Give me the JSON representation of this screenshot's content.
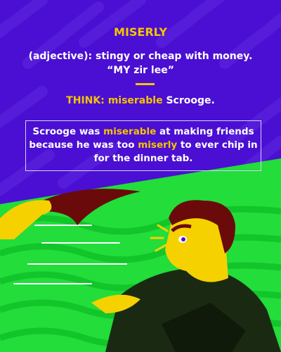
{
  "word": "MISERLY",
  "definition": "(adjective): stingy or cheap with money.",
  "pronunciation": "“MY zir lee”",
  "think": {
    "prefix": "THINK:",
    "highlight": "miserable",
    "suffix": "Scrooge."
  },
  "example": {
    "part1": "Scrooge was ",
    "hl1": "miserable",
    "part2": " at making friends because he was too ",
    "hl2": "miserly",
    "part3": " to ever chip in for the dinner tab."
  },
  "colors": {
    "background": "#4a0fd2",
    "accent": "#f5c400",
    "grass": "#22dd3a"
  }
}
